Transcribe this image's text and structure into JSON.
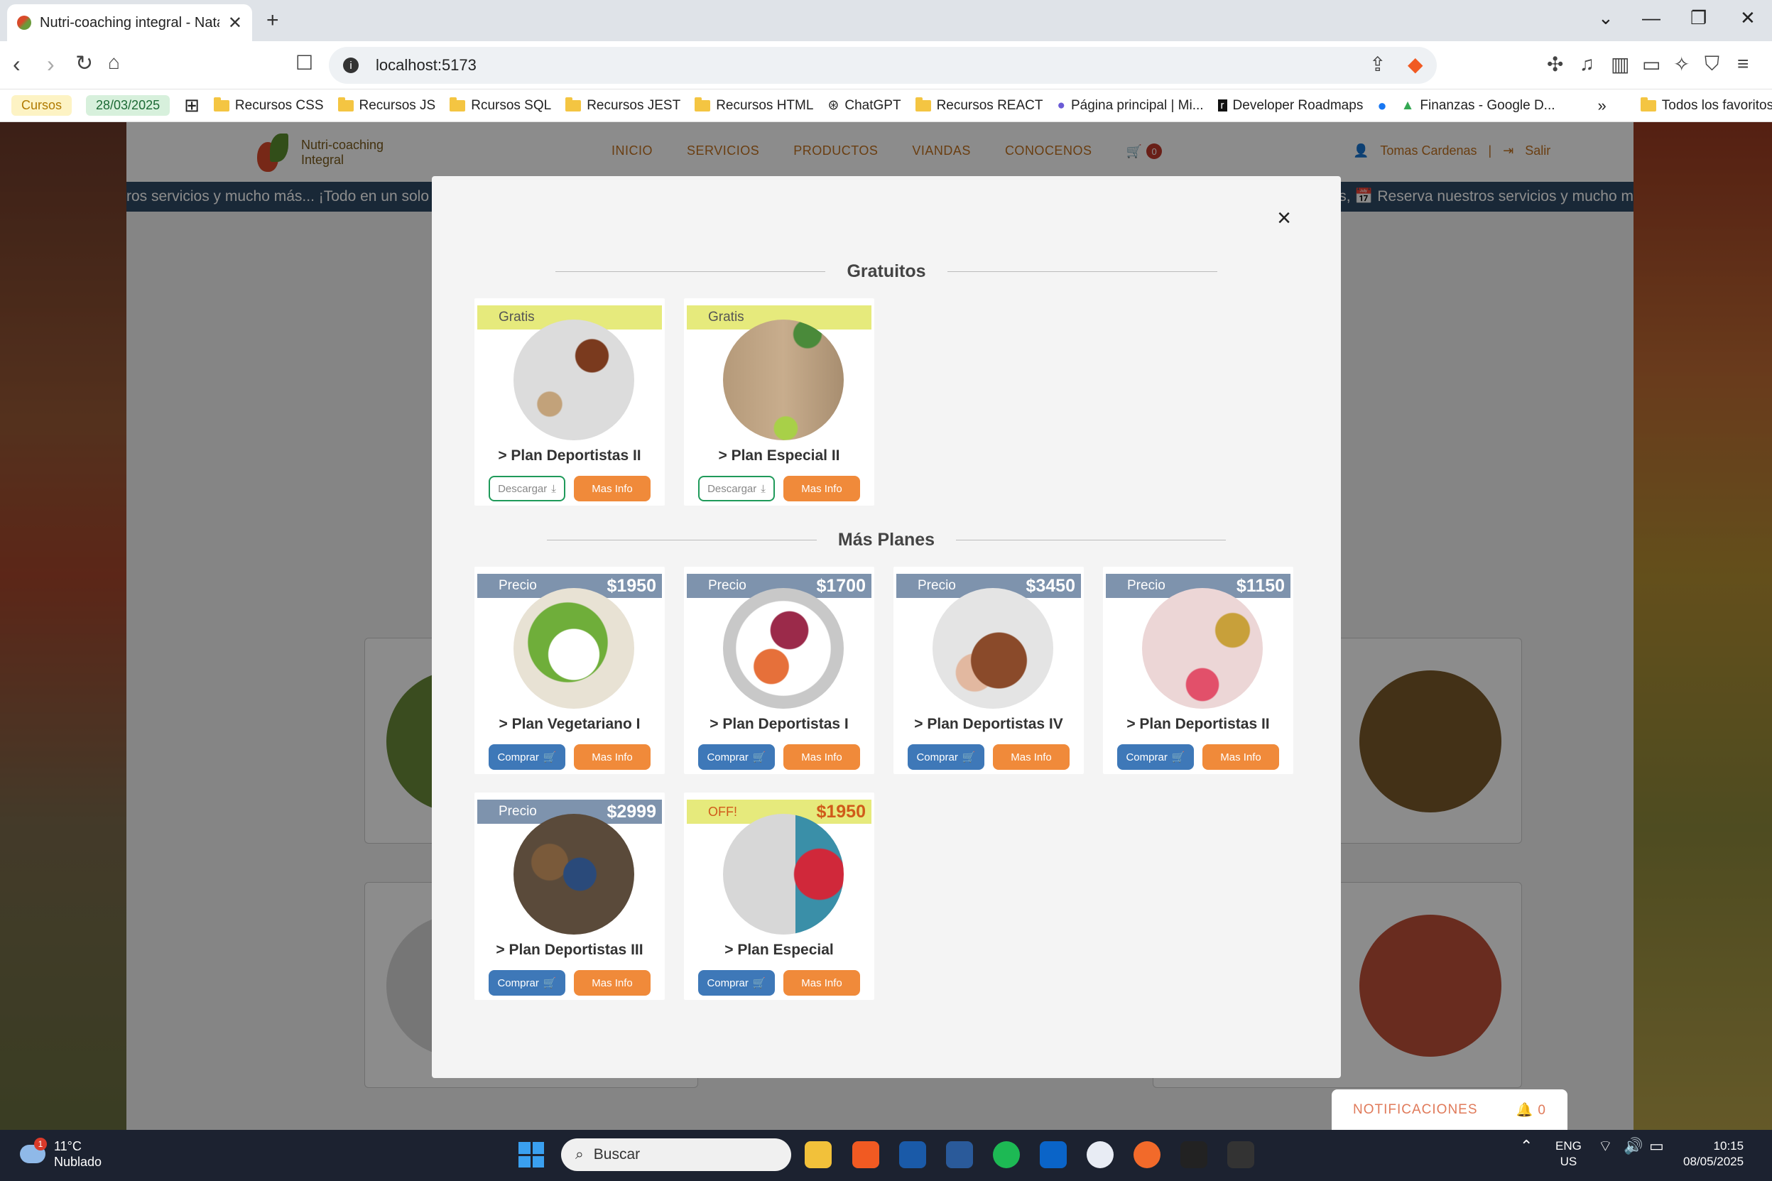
{
  "browser": {
    "tab_title": "Nutri-coaching integral - Natas",
    "address": "localhost:5173",
    "bookmarks": [
      {
        "label": "Cursos",
        "style": "yellow"
      },
      {
        "label": "28/03/2025",
        "style": "green"
      },
      {
        "label": "Recursos CSS"
      },
      {
        "label": "Recursos JS"
      },
      {
        "label": "Rcursos SQL"
      },
      {
        "label": "Recursos JEST"
      },
      {
        "label": "Recursos HTML"
      },
      {
        "label": "ChatGPT"
      },
      {
        "label": "Recursos REACT"
      },
      {
        "label": "Página principal | Mi..."
      },
      {
        "label": "Developer Roadmaps"
      },
      {
        "label": "Finanzas - Google D..."
      },
      {
        "label": "Todos los favoritos"
      }
    ]
  },
  "site": {
    "logo_line1": "Nutri-coaching",
    "logo_line2": "Integral",
    "nav": [
      "INICIO",
      "SERVICIOS",
      "PRODUCTOS",
      "VIANDAS",
      "CONOCENOS"
    ],
    "cart_count": "0",
    "user_name": "Tomas Cardenas",
    "separator": "|",
    "logout": "Salir",
    "ticker_left": "ros servicios y mucho más... ¡Todo en un solo",
    "ticker_right": "vos, 📅 Reserva nuestros servicios y mucho m"
  },
  "modal": {
    "close": "×",
    "free_title": "Gratuitos",
    "more_title": "Más Planes",
    "free_plans": [
      {
        "badge": "Gratis",
        "name": "> Plan Deportistas II",
        "download": "Descargar",
        "info": "Mas Info"
      },
      {
        "badge": "Gratis",
        "name": "> Plan Especial II",
        "download": "Descargar",
        "info": "Mas Info"
      }
    ],
    "paid_plans": [
      {
        "label": "Precio",
        "price": "$1950",
        "name": "> Plan Vegetariano I",
        "buy": "Comprar",
        "info": "Mas Info"
      },
      {
        "label": "Precio",
        "price": "$1700",
        "name": "> Plan Deportistas I",
        "buy": "Comprar",
        "info": "Mas Info"
      },
      {
        "label": "Precio",
        "price": "$3450",
        "name": "> Plan Deportistas IV",
        "buy": "Comprar",
        "info": "Mas Info"
      },
      {
        "label": "Precio",
        "price": "$1150",
        "name": "> Plan Deportistas II",
        "buy": "Comprar",
        "info": "Mas Info"
      },
      {
        "label": "Precio",
        "price": "$2999",
        "name": "> Plan Deportistas III",
        "buy": "Comprar",
        "info": "Mas Info"
      },
      {
        "label": "OFF!",
        "price": "$1950",
        "name": "> Plan Especial",
        "buy": "Comprar",
        "info": "Mas Info"
      }
    ]
  },
  "notifications": {
    "label": "NOTIFICACIONES",
    "count": "0"
  },
  "taskbar": {
    "temp": "11°C",
    "weather": "Nublado",
    "weather_badge": "1",
    "search_placeholder": "Buscar",
    "lang1": "ENG",
    "lang2": "US",
    "time": "10:15",
    "date": "08/05/2025"
  }
}
